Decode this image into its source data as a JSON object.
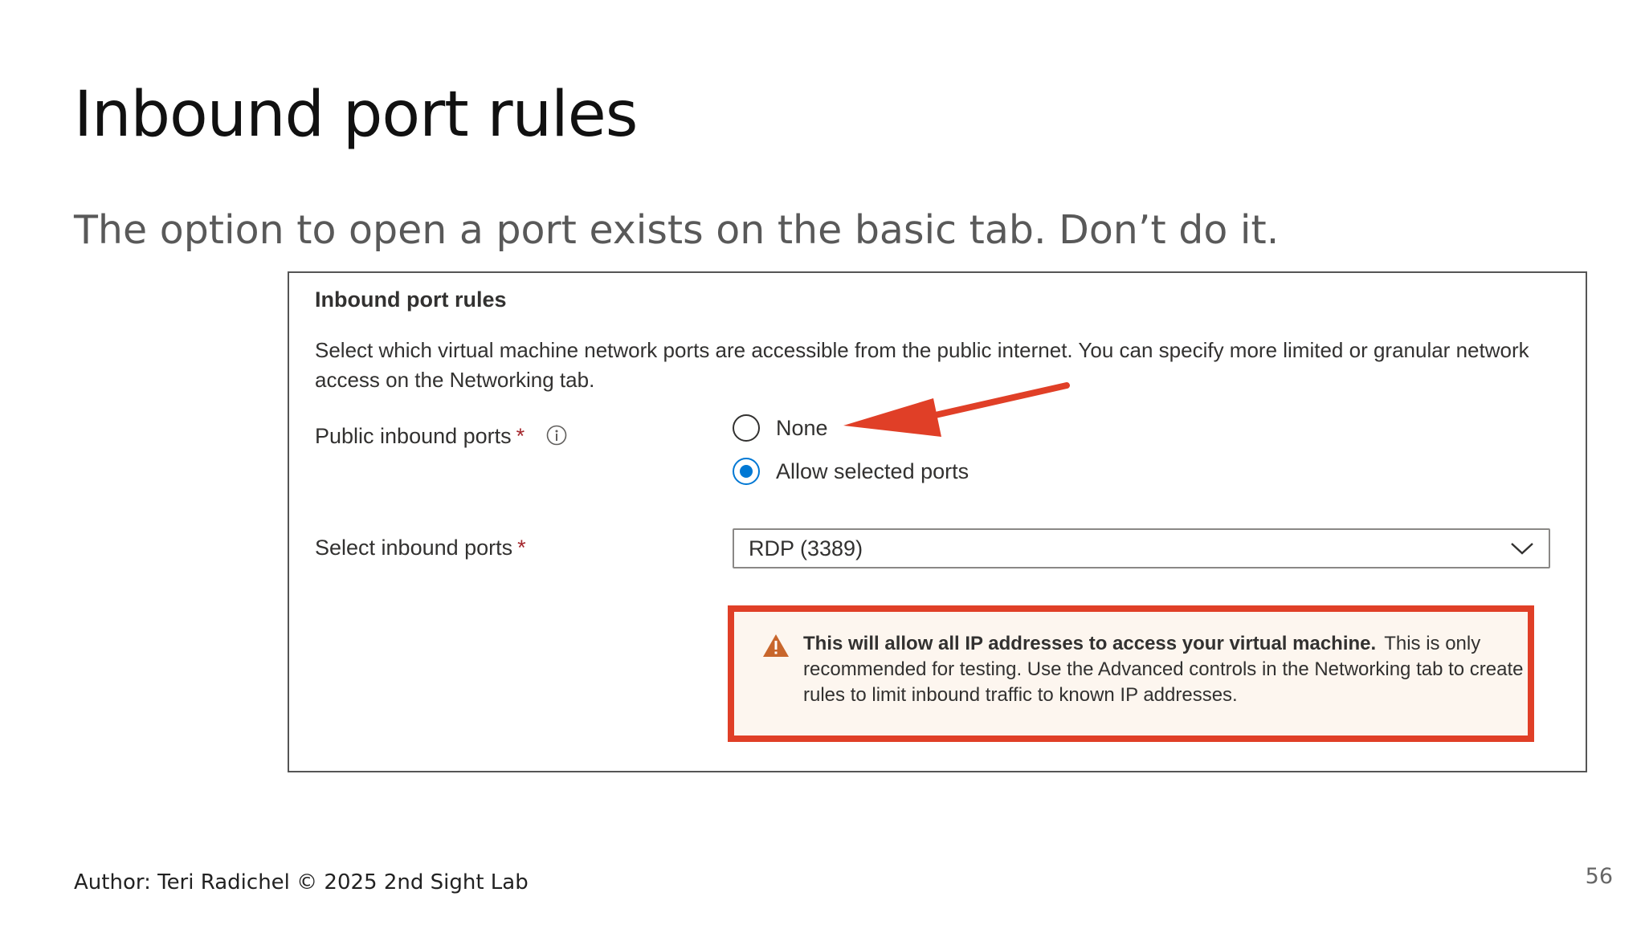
{
  "slide": {
    "title": "Inbound port rules",
    "subtitle": "The option to open a port exists on the basic tab. Don’t do it.",
    "author": "Author: Teri Radichel © 2025 2nd Sight Lab",
    "page_number": "56"
  },
  "panel": {
    "heading": "Inbound port rules",
    "description": "Select which virtual machine network ports are accessible from the public internet. You can specify more limited or granular network access on the Networking tab.",
    "public_inbound_ports": {
      "label": "Public inbound ports",
      "required_mark": "*",
      "info_icon": "info-icon",
      "options": [
        {
          "label": "None",
          "selected": false
        },
        {
          "label": "Allow selected ports",
          "selected": true
        }
      ]
    },
    "select_inbound_ports": {
      "label": "Select inbound ports",
      "required_mark": "*",
      "selected_value": "RDP (3389)",
      "icon": "chevron-down-icon"
    },
    "warning": {
      "icon": "warning-triangle-icon",
      "bold_text": "This will allow all IP addresses to access your virtual machine.",
      "text": "This is only recommended for testing.  Use the Advanced controls in the Networking tab to create rules to limit inbound traffic to known IP addresses."
    },
    "annotation": {
      "arrow_color": "#e03f27",
      "highlight_color": "#e03f27",
      "points_to": "None"
    }
  },
  "colors": {
    "accent_blue": "#0078d4",
    "required_red": "#a4262c",
    "warning_orange": "#c8662c",
    "annotation_red": "#e03f27"
  }
}
